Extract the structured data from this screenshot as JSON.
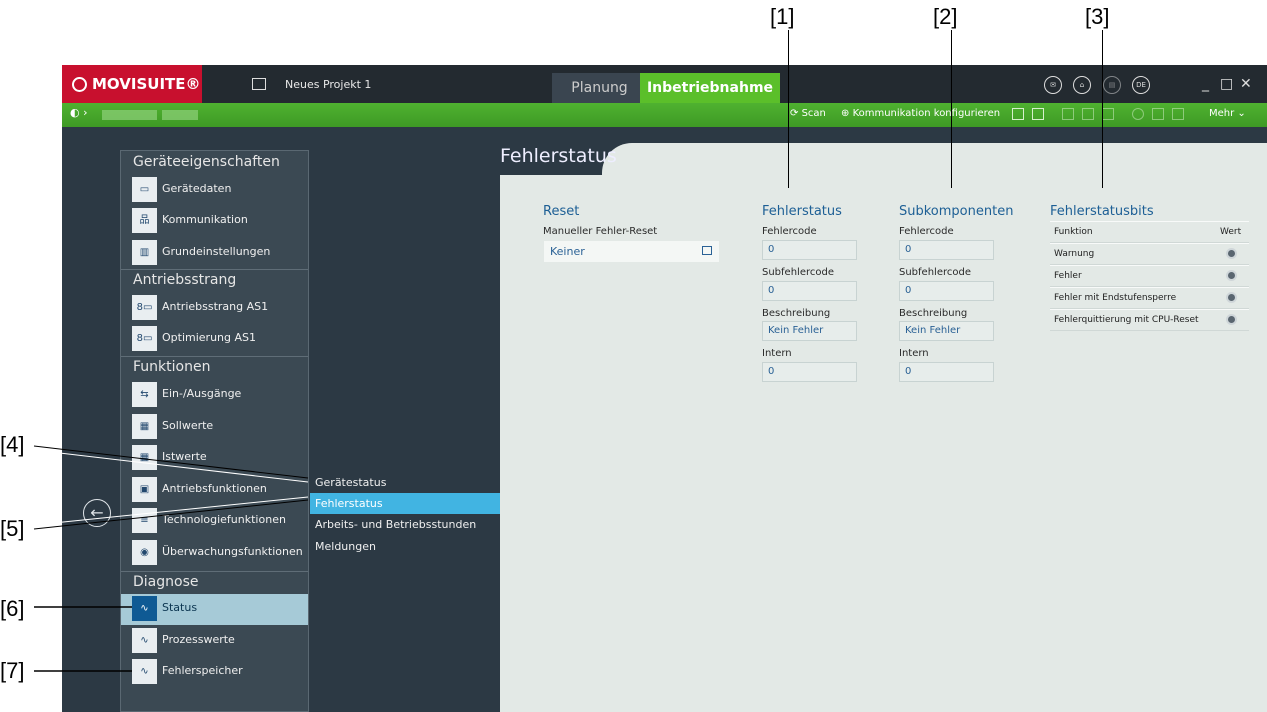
{
  "callouts": {
    "c1": "[1]",
    "c2": "[2]",
    "c3": "[3]",
    "c4": "[4]",
    "c5": "[5]",
    "c6": "[6]",
    "c7": "[7]"
  },
  "titlebar": {
    "brand": "MOVISUITE®",
    "project": "Neues Projekt 1",
    "tab_planung": "Planung",
    "tab_inbetriebnahme": "Inbetriebnahme",
    "lang": "DE"
  },
  "toolbar": {
    "scan": "Scan",
    "comm": "Kommunikation konfigurieren",
    "mehr": "Mehr"
  },
  "sidebar": {
    "sections": [
      "Geräteeigenschaften",
      "Antriebsstrang",
      "Funktionen",
      "Diagnose"
    ],
    "items": [
      "Gerätedaten",
      "Kommunikation",
      "Grundeinstellungen",
      "Antriebsstrang AS1",
      "Optimierung AS1",
      "Ein-/Ausgänge",
      "Sollwerte",
      "Istwerte",
      "Antriebsfunktionen",
      "Technologiefunktionen",
      "Überwachungsfunktionen",
      "Status",
      "Prozesswerte",
      "Fehlerspeicher"
    ]
  },
  "subnav": [
    "Gerätestatus",
    "Fehlerstatus",
    "Arbeits- und Betriebsstunden",
    "Meldungen"
  ],
  "content": {
    "title": "Fehlerstatus",
    "reset": {
      "heading": "Reset",
      "label": "Manueller Fehler-Reset",
      "value": "Keiner"
    },
    "fehlerstatus": {
      "heading": "Fehlerstatus",
      "fields": [
        {
          "label": "Fehlercode",
          "value": "0"
        },
        {
          "label": "Subfehlercode",
          "value": "0"
        },
        {
          "label": "Beschreibung",
          "value": "Kein Fehler"
        },
        {
          "label": "Intern",
          "value": "0"
        }
      ]
    },
    "subkomponenten": {
      "heading": "Subkomponenten",
      "fields": [
        {
          "label": "Fehlercode",
          "value": "0"
        },
        {
          "label": "Subfehlercode",
          "value": "0"
        },
        {
          "label": "Beschreibung",
          "value": "Kein Fehler"
        },
        {
          "label": "Intern",
          "value": "0"
        }
      ]
    },
    "bits": {
      "heading": "Fehlerstatusbits",
      "col_funktion": "Funktion",
      "col_wert": "Wert",
      "rows": [
        "Warnung",
        "Fehler",
        "Fehler mit Endstufensperre",
        "Fehlerquittierung mit CPU-Reset"
      ]
    }
  }
}
